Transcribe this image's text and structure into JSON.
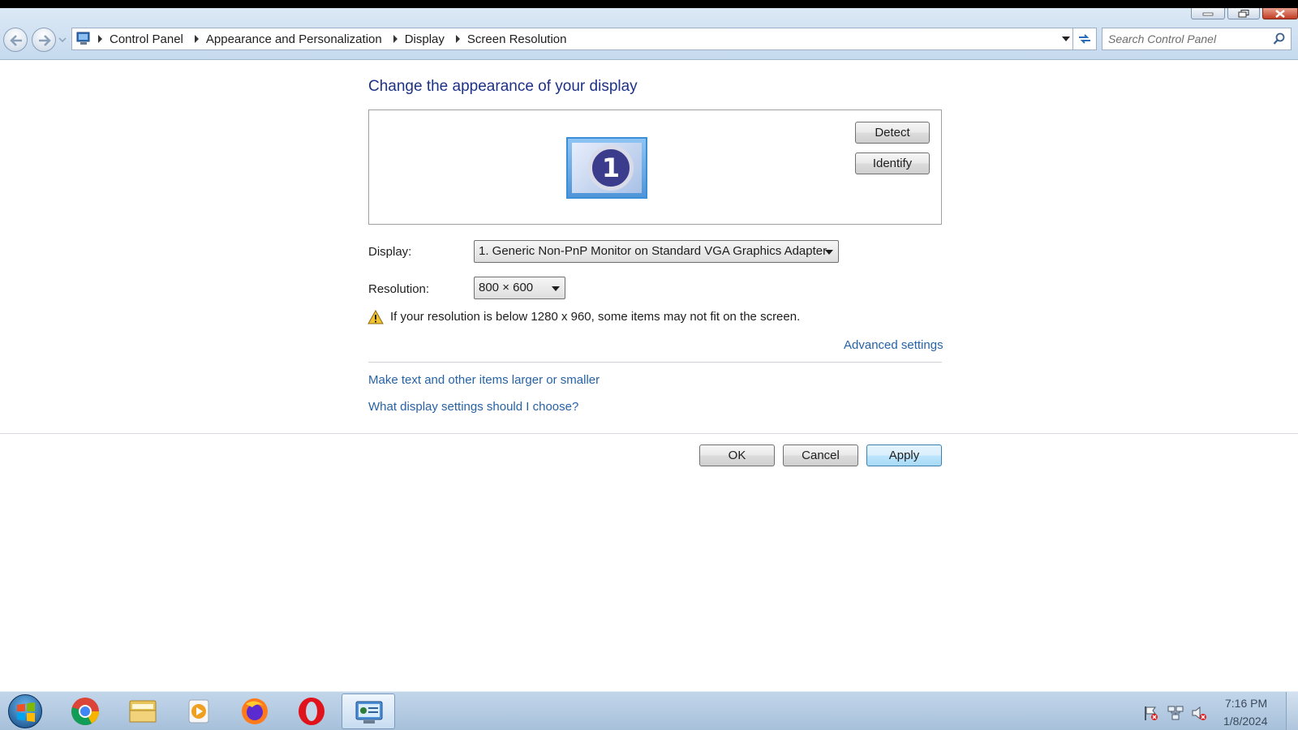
{
  "address": {
    "crumbs": [
      "Control Panel",
      "Appearance and Personalization",
      "Display",
      "Screen Resolution"
    ],
    "search_placeholder": "Search Control Panel"
  },
  "main": {
    "title": "Change the appearance of your display",
    "monitor_number": "1",
    "detect_label": "Detect",
    "identify_label": "Identify",
    "display_label": "Display:",
    "display_value": "1. Generic Non-PnP Monitor on Standard VGA Graphics Adapter",
    "resolution_label": "Resolution:",
    "resolution_value": "800 × 600",
    "warning_text": "If your resolution is below 1280 x 960, some items may not fit on the screen.",
    "advanced_link": "Advanced settings",
    "link_larger": "Make text and other items larger or smaller",
    "link_choose": "What display settings should I choose?"
  },
  "actions": {
    "ok": "OK",
    "cancel": "Cancel",
    "apply": "Apply"
  },
  "taskbar": {
    "apps": [
      "chrome-icon",
      "file-explorer-icon",
      "media-player-icon",
      "firefox-icon",
      "opera-icon",
      "control-panel-icon"
    ],
    "time": "7:16 PM",
    "date": "1/8/2024"
  },
  "colors": {
    "title_blue": "#1e3287",
    "link_blue": "#2662a6",
    "apply_blue": "#a7d9f5"
  }
}
